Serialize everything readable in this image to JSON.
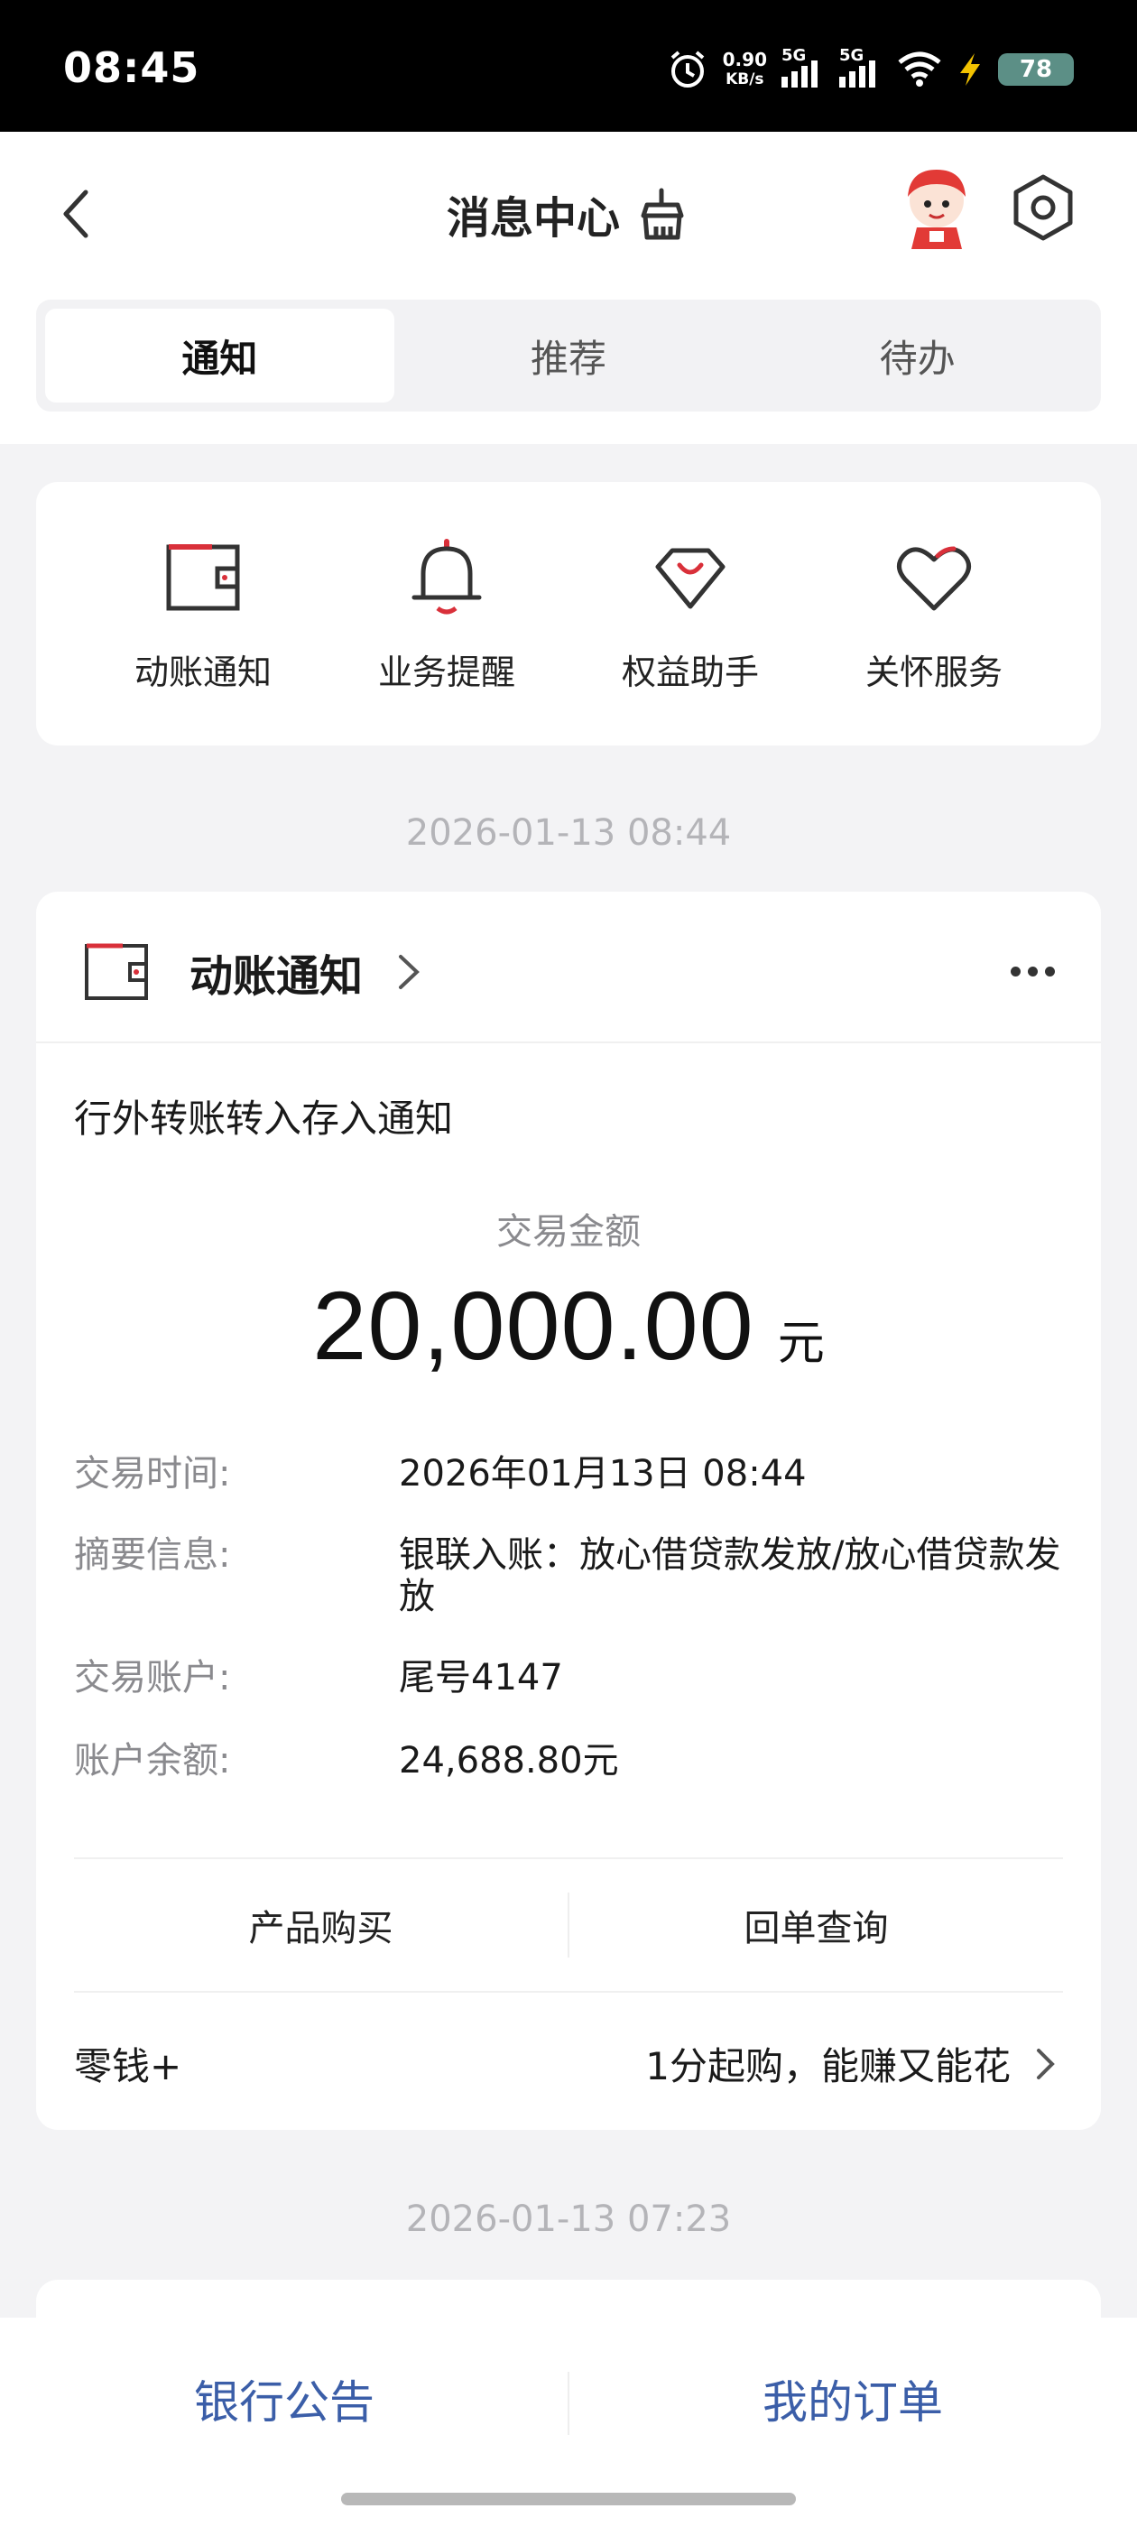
{
  "status_bar": {
    "time": "08:45",
    "net_speed_value": "0.90",
    "net_speed_unit": "KB/s",
    "signal1_label": "5G",
    "signal2_label": "5G",
    "battery": "78"
  },
  "header": {
    "title": "消息中心"
  },
  "tabs": [
    {
      "label": "通知",
      "active": true
    },
    {
      "label": "推荐",
      "active": false
    },
    {
      "label": "待办",
      "active": false
    }
  ],
  "shortcuts": [
    {
      "label": "动账通知",
      "icon": "wallet-icon"
    },
    {
      "label": "业务提醒",
      "icon": "bell-icon"
    },
    {
      "label": "权益助手",
      "icon": "diamond-icon"
    },
    {
      "label": "关怀服务",
      "icon": "heart-icon"
    }
  ],
  "timestamps": [
    "2026-01-13 08:44",
    "2026-01-13 07:23"
  ],
  "notice": {
    "category": "动账通知",
    "title": "行外转账转入存入通知",
    "amount_label": "交易金额",
    "amount": "20,000.00",
    "amount_unit": "元",
    "details": [
      {
        "key": "交易时间:",
        "value": "2026年01月13日 08:44"
      },
      {
        "key": "摘要信息:",
        "value": "银联入账：放心借贷款发放/放心借贷款发放"
      },
      {
        "key": "交易账户:",
        "value": "尾号4147"
      },
      {
        "key": "账户余额:",
        "value": "24,688.80元"
      }
    ],
    "actions": [
      "产品购买",
      "回单查询"
    ],
    "promo_name": "零钱+",
    "promo_desc": "1分起购，能赚又能花"
  },
  "bottom_bar": {
    "left": "银行公告",
    "right": "我的订单"
  },
  "colors": {
    "accent_red": "#d9303a",
    "link_blue": "#3b5ea8",
    "battery_green": "#5c8f86"
  }
}
